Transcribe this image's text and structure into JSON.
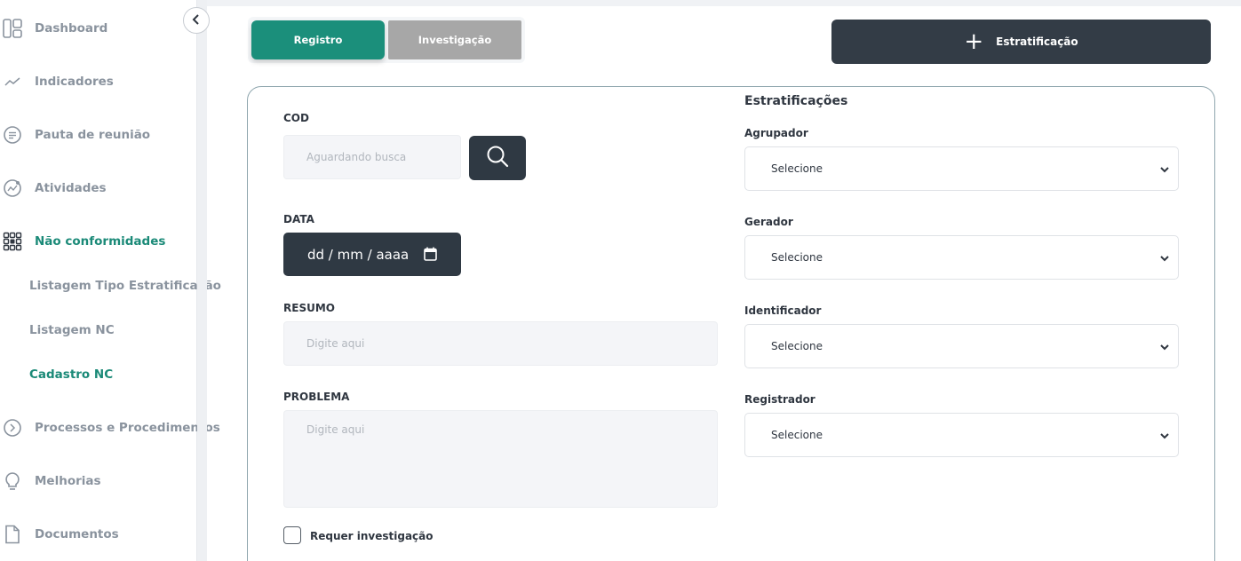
{
  "sidebar": {
    "items": [
      {
        "label": "Dashboard",
        "icon": "dashboard-icon"
      },
      {
        "label": "Indicadores",
        "icon": "trend-icon"
      },
      {
        "label": "Pauta de reunião",
        "icon": "list-circle-icon"
      },
      {
        "label": "Atividades",
        "icon": "activity-icon"
      },
      {
        "label": "Não conformidades",
        "icon": "grid-icon"
      },
      {
        "label": "Processos e Procedimentos",
        "icon": "chevron-circle-icon"
      },
      {
        "label": "Melhorias",
        "icon": "lightbulb-icon"
      },
      {
        "label": "Documentos",
        "icon": "document-icon"
      }
    ],
    "subitems": [
      {
        "label": "Listagem Tipo Estratificação"
      },
      {
        "label": "Listagem NC"
      },
      {
        "label": "Cadastro NC"
      }
    ]
  },
  "tabs": {
    "registro": "Registro",
    "investigacao": "Investigação"
  },
  "estratificacao_button": "Estratificação",
  "form": {
    "cod_label": "COD",
    "cod_placeholder": "Aguardando busca",
    "data_label": "DATA",
    "data_value": "dd / mm / aaaa",
    "resumo_label": "RESUMO",
    "resumo_placeholder": "Digite aqui",
    "problema_label": "PROBLEMA",
    "problema_placeholder": "Digite aqui",
    "checkbox_label": "Requer investigação"
  },
  "estratificacoes": {
    "title": "Estratificações",
    "fields": [
      {
        "label": "Agrupador",
        "value": "Selecione"
      },
      {
        "label": "Gerador",
        "value": "Selecione"
      },
      {
        "label": "Identificador",
        "value": "Selecione"
      },
      {
        "label": "Registrador",
        "value": "Selecione"
      }
    ]
  },
  "colors": {
    "accent": "#1b8f7b",
    "dark": "#2f3943",
    "muted": "#8a939e",
    "tab_inactive": "#a7a7a7"
  }
}
